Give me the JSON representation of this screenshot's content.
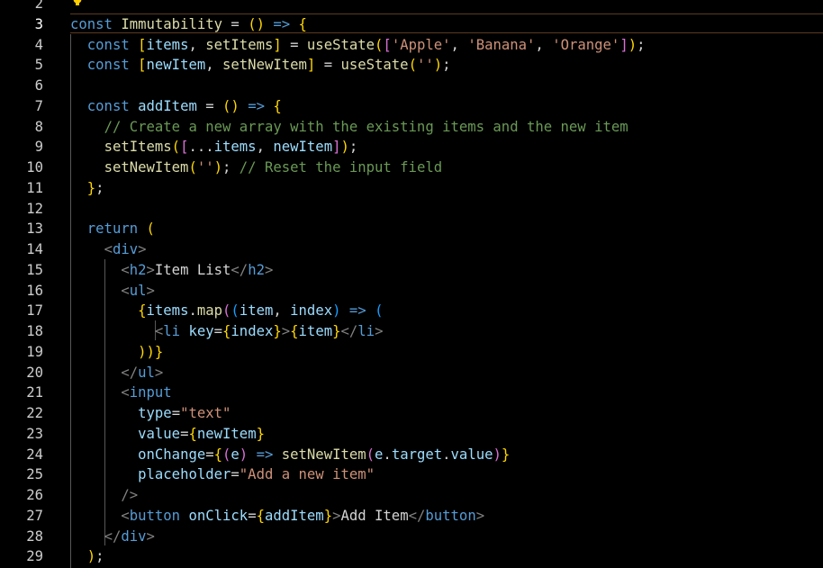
{
  "editor": {
    "active_line": "3",
    "lines": [
      {
        "number": "2",
        "text": ""
      },
      {
        "number": "3",
        "text": "const Immutability = () => {"
      },
      {
        "number": "4",
        "text": "  const [items, setItems] = useState(['Apple', 'Banana', 'Orange']);"
      },
      {
        "number": "5",
        "text": "  const [newItem, setNewItem] = useState('');"
      },
      {
        "number": "6",
        "text": ""
      },
      {
        "number": "7",
        "text": "  const addItem = () => {"
      },
      {
        "number": "8",
        "text": "    // Create a new array with the existing items and the new item"
      },
      {
        "number": "9",
        "text": "    setItems([...items, newItem]);"
      },
      {
        "number": "10",
        "text": "    setNewItem(''); // Reset the input field"
      },
      {
        "number": "11",
        "text": "  };"
      },
      {
        "number": "12",
        "text": ""
      },
      {
        "number": "13",
        "text": "  return ("
      },
      {
        "number": "14",
        "text": "    <div>"
      },
      {
        "number": "15",
        "text": "      <h2>Item List</h2>"
      },
      {
        "number": "16",
        "text": "      <ul>"
      },
      {
        "number": "17",
        "text": "        {items.map((item, index) => ("
      },
      {
        "number": "18",
        "text": "          <li key={index}>{item}</li>"
      },
      {
        "number": "19",
        "text": "        ))}"
      },
      {
        "number": "20",
        "text": "      </ul>"
      },
      {
        "number": "21",
        "text": "      <input"
      },
      {
        "number": "22",
        "text": "        type=\"text\""
      },
      {
        "number": "23",
        "text": "        value={newItem}"
      },
      {
        "number": "24",
        "text": "        onChange={(e) => setNewItem(e.target.value)}"
      },
      {
        "number": "25",
        "text": "        placeholder=\"Add a new item\""
      },
      {
        "number": "26",
        "text": "      />"
      },
      {
        "number": "27",
        "text": "      <button onClick={addItem}>Add Item</button>"
      },
      {
        "number": "28",
        "text": "    </div>"
      },
      {
        "number": "29",
        "text": "  );"
      }
    ]
  },
  "colors": {
    "background": "#000000",
    "keyword": "#569cd6",
    "function": "#dcdcaa",
    "variable": "#9cdcfe",
    "string": "#ce9178",
    "comment": "#6a9955",
    "bracket_level1": "#ffd700",
    "bracket_level2": "#da70d6",
    "bracket_level3": "#179fff",
    "current_line_border": "#5a3a20"
  },
  "icons": {
    "gutter_hint": "lightbulb-icon"
  }
}
